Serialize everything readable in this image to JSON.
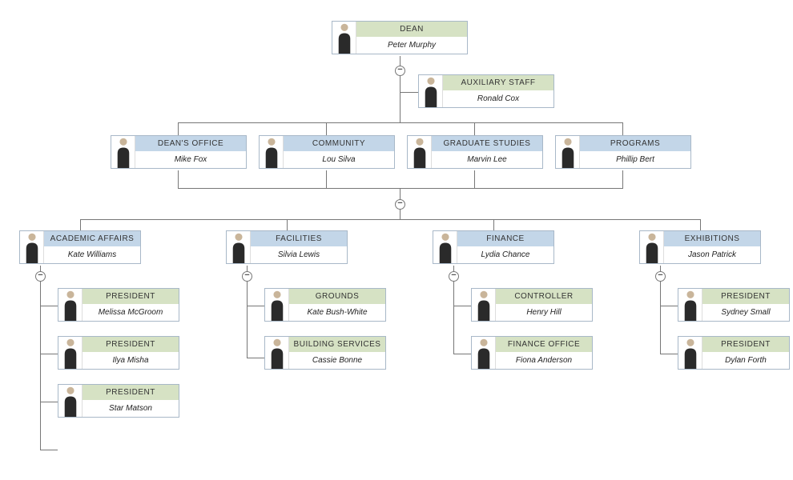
{
  "org": {
    "dean": {
      "title": "DEAN",
      "name": "Peter Murphy"
    },
    "aux": {
      "title": "AUXILIARY STAFF",
      "name": "Ronald Cox"
    },
    "deansOffice": {
      "title": "DEAN'S OFFICE",
      "name": "Mike Fox"
    },
    "community": {
      "title": "COMMUNITY",
      "name": "Lou Silva"
    },
    "graduate": {
      "title": "GRADUATE STUDIES",
      "name": "Marvin Lee"
    },
    "programs": {
      "title": "PROGRAMS",
      "name": "Phillip Bert"
    },
    "academic": {
      "title": "ACADEMIC AFFAIRS",
      "name": "Kate Williams"
    },
    "facilities": {
      "title": "FACILITIES",
      "name": "Silvia Lewis"
    },
    "finance": {
      "title": "FINANCE",
      "name": "Lydia Chance"
    },
    "exhibitions": {
      "title": "EXHIBITIONS",
      "name": "Jason Patrick"
    },
    "president1": {
      "title": "PRESIDENT",
      "name": "Melissa McGroom"
    },
    "president2": {
      "title": "PRESIDENT",
      "name": "Ilya Misha"
    },
    "president3": {
      "title": "PRESIDENT",
      "name": "Star Matson"
    },
    "grounds": {
      "title": "GROUNDS",
      "name": "Kate Bush-White"
    },
    "building": {
      "title": "BUILDING SERVICES",
      "name": "Cassie Bonne"
    },
    "controller": {
      "title": "CONTROLLER",
      "name": "Henry Hill"
    },
    "finoffice": {
      "title": "FINANCE OFFICE",
      "name": "Fiona Anderson"
    },
    "president4": {
      "title": "PRESIDENT",
      "name": "Sydney Small"
    },
    "president5": {
      "title": "PRESIDENT",
      "name": "Dylan Forth"
    }
  },
  "toggle_glyph": "−",
  "colors": {
    "green": "#d6e2c4",
    "blue": "#c3d6e8",
    "border": "#a8b8c8",
    "line": "#777777"
  }
}
